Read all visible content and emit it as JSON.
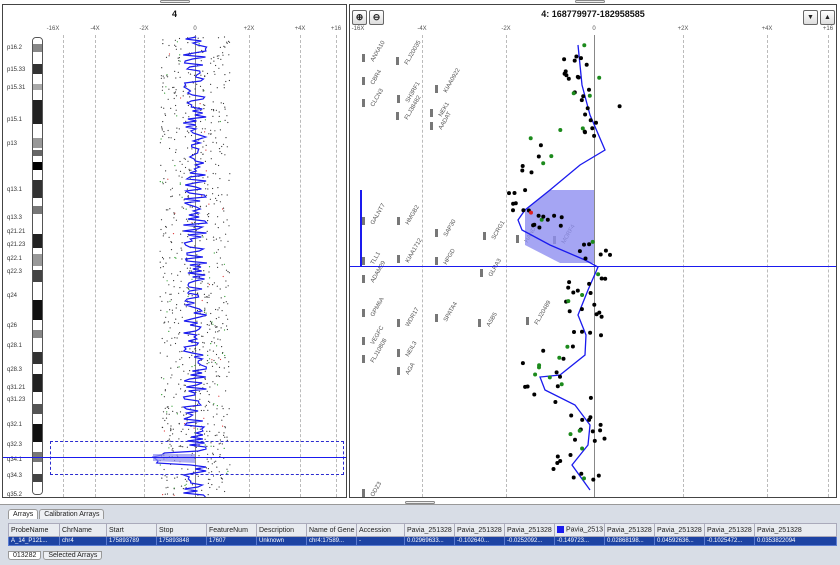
{
  "chromosome_view": {
    "title": "4",
    "axis_ticks": [
      "-16X",
      "-4X",
      "-2X",
      "0",
      "+2X",
      "+4X",
      "+16"
    ],
    "bands": [
      "p16.2",
      "p15.33",
      "p15.31",
      "p15.1",
      "p13",
      "q13.1",
      "q13.3",
      "q21.21",
      "q21.23",
      "q22.1",
      "q22.3",
      "q24",
      "q26",
      "q28.1",
      "q28.3",
      "q31.21",
      "q31.23",
      "q32.1",
      "q32.3",
      "q34.1",
      "q34.3",
      "q35.2"
    ]
  },
  "gene_view": {
    "title": "4: 168779977-182958585",
    "axis_ticks": [
      "-16X",
      "-4X",
      "-2X",
      "0",
      "+2X",
      "+4X",
      "+16"
    ],
    "zoom_in": "zoom-in-icon",
    "zoom_out": "zoom-out-icon",
    "genes": [
      "ANXA10",
      "FLJ20035",
      "CBR4",
      "SH3RF1",
      "KIAA0922",
      "CLCN3",
      "FLJ38482",
      "NEK1",
      "AADAT",
      "GALNT7",
      "HMGB2",
      "SAP30",
      "SCRG1",
      "HAND2",
      "MORF4",
      "TLL1",
      "KIAA1712",
      "HPGD",
      "GLRA3",
      "ADAM29",
      "GPM6A",
      "WDR17",
      "SPATA4",
      "ASB5",
      "FLJ20489",
      "VEGFC",
      "FLJ10808",
      "NEIL3",
      "AGA",
      "ODZ3"
    ]
  },
  "tabs": {
    "arrays": "Arrays",
    "calibration": "Calibration Arrays"
  },
  "table": {
    "columns": [
      "ProbeName",
      "ChrName",
      "Start",
      "Stop",
      "FeatureNum",
      "Description",
      "Name of Gene",
      "Accession",
      "Pavia_251328",
      "Pavia_251328",
      "Pavia_251328",
      "Pavia_2513",
      "Pavia_251328",
      "Pavia_251328",
      "Pavia_251328",
      "Pavia_251328"
    ],
    "row": [
      "A_14_P121...",
      "chr4",
      "175893789",
      "175893848",
      "17607",
      "Unknown",
      "chr4:17589...",
      "-",
      "0.02969633...",
      "-0.102640...",
      "-0.0252092...",
      "-0.149723...",
      "0.02868198...",
      "0.04592636...",
      "-0.1025472...",
      "0.0353822094"
    ]
  },
  "bottom_tabs": {
    "sample": "013282",
    "selected": "Selected Arrays"
  },
  "colors": {
    "profile": "#1a1aee",
    "highlight": "#8f8ff0",
    "row_selected": "#1d43a3"
  }
}
